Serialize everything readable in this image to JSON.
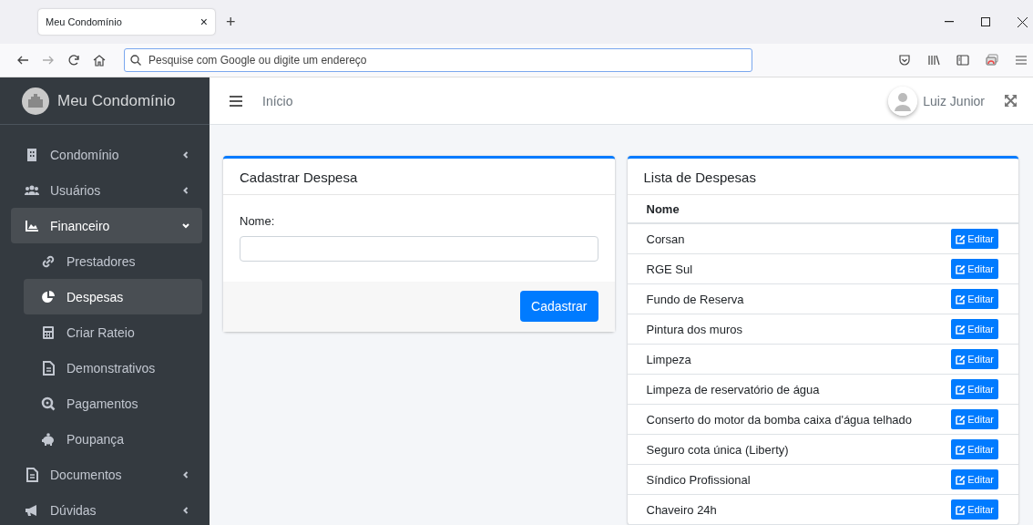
{
  "browser": {
    "tab": {
      "title": "Meu Condomínio",
      "close": "×"
    },
    "new_tab": "+",
    "address_bar": {
      "placeholder": "Pesquise com Google ou digite um endereço"
    }
  },
  "sidebar": {
    "brand": "Meu Condomínio",
    "items": [
      {
        "label": "Condomínio",
        "expanded": false
      },
      {
        "label": "Usuários",
        "expanded": false
      },
      {
        "label": "Financeiro",
        "expanded": true,
        "children": [
          {
            "label": "Prestadores",
            "selected": false
          },
          {
            "label": "Despesas",
            "selected": true
          },
          {
            "label": "Criar Rateio",
            "selected": false
          },
          {
            "label": "Demonstrativos",
            "selected": false
          },
          {
            "label": "Pagamentos",
            "selected": false
          },
          {
            "label": "Poupança",
            "selected": false
          }
        ]
      },
      {
        "label": "Documentos",
        "expanded": false
      },
      {
        "label": "Dúvidas",
        "expanded": false
      }
    ]
  },
  "navbar": {
    "breadcrumb": "Início",
    "user": "Luiz Junior"
  },
  "form_card": {
    "title": "Cadastrar Despesa",
    "field_label": "Nome:",
    "submit": "Cadastrar"
  },
  "list_card": {
    "title": "Lista de Despesas",
    "column": "Nome",
    "rows": [
      {
        "name": "Corsan",
        "action": "Editar"
      },
      {
        "name": "RGE Sul",
        "action": "Editar"
      },
      {
        "name": "Fundo de Reserva",
        "action": "Editar"
      },
      {
        "name": "Pintura dos muros",
        "action": "Editar"
      },
      {
        "name": "Limpeza",
        "action": "Editar"
      },
      {
        "name": "Limpeza de reservatório de água",
        "action": "Editar"
      },
      {
        "name": "Conserto do motor da bomba caixa d'água telhado",
        "action": "Editar"
      },
      {
        "name": "Seguro cota única (Liberty)",
        "action": "Editar"
      },
      {
        "name": "Síndico Profissional",
        "action": "Editar"
      },
      {
        "name": "Chaveiro 24h",
        "action": "Editar"
      }
    ]
  }
}
